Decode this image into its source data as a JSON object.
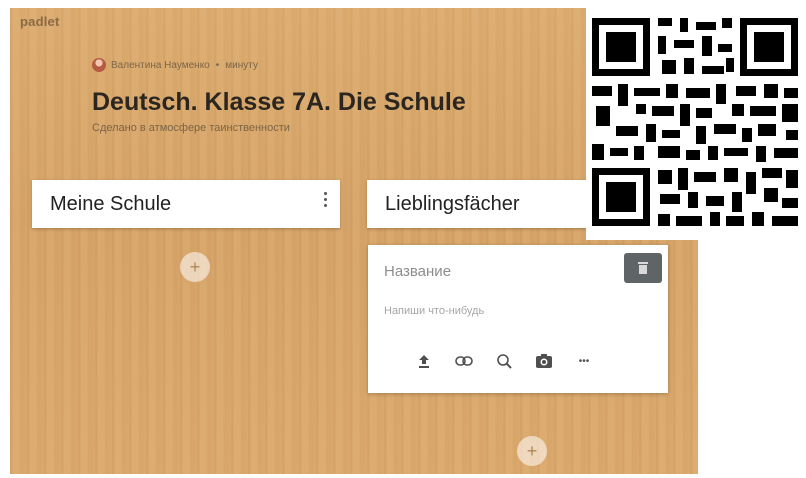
{
  "app": {
    "logo": "padlet"
  },
  "header": {
    "author": "Валентина Науменко",
    "time_ago": "минуту",
    "separator": "•",
    "title": "Deutsch. Klasse 7A. Die Schule",
    "subtitle": "Сделано в атмосфере таинственности"
  },
  "columns": [
    {
      "title": "Meine Schule"
    },
    {
      "title": "Lieblingsfächer"
    }
  ],
  "add_label": "+",
  "card": {
    "title_placeholder": "Название",
    "body_placeholder": "Напиши что-нибудь",
    "more_label": "•••"
  },
  "colors": {
    "board": "#d8a86c",
    "trash_button": "#5f6466"
  },
  "icons": [
    "upload-icon",
    "link-icon",
    "search-icon",
    "camera-icon",
    "more-icon",
    "trash-icon",
    "kebab-icon",
    "qr-code"
  ]
}
